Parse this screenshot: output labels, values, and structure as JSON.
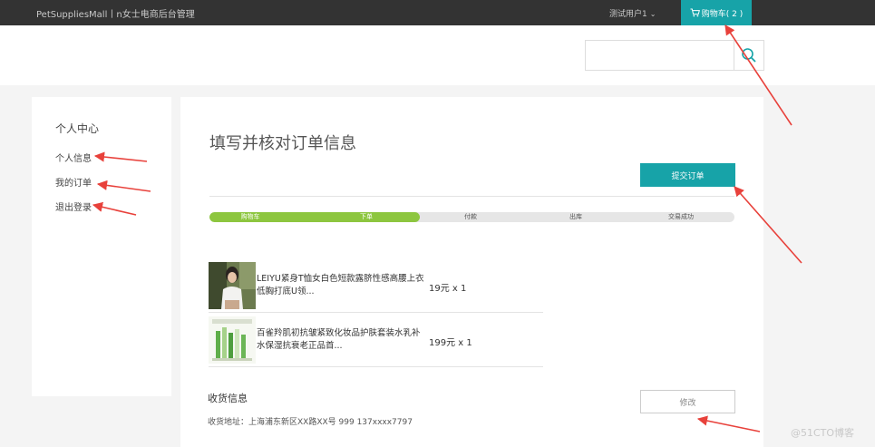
{
  "topbar": {
    "brand": "PetSuppliesMall丨n女士电商后台管理",
    "user": "测试用户1",
    "cart_label": "购物车( 2 )"
  },
  "search": {
    "placeholder": ""
  },
  "sidebar": {
    "title": "个人中心",
    "items": [
      {
        "label": "个人信息"
      },
      {
        "label": "我的订单"
      },
      {
        "label": "退出登录"
      }
    ]
  },
  "main": {
    "title": "填写并核对订单信息",
    "submit_label": "提交订单",
    "steps": [
      "购物车",
      "下单",
      "付款",
      "出库",
      "交易成功"
    ],
    "progress_fraction": 0.4,
    "items": [
      {
        "name": "LEIYU紧身T恤女白色短款露脐性感高腰上衣低胸打底U领...",
        "price": "19元 x 1"
      },
      {
        "name": "百雀羚肌初抗皱紧致化妆品护肤套装水乳补水保湿抗衰老正品首...",
        "price": "199元 x 1"
      }
    ],
    "shipping_title": "收货信息",
    "shipping_address": "收货地址：上海浦东新区XX路XX号 999 137xxxx7797",
    "edit_label": "修改"
  },
  "watermark": "@51CTO博客",
  "colors": {
    "accent": "#17a3a8",
    "progress": "#8dc63f",
    "arrow": "#e8413b",
    "topbar": "#333333"
  },
  "icons": [
    "cart-icon",
    "search-icon",
    "chevron-down-icon"
  ]
}
